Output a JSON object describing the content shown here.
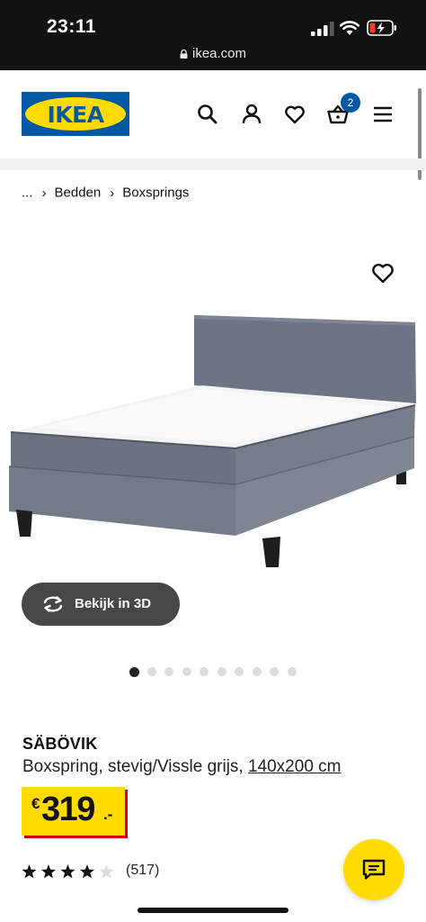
{
  "status_bar": {
    "time": "23:11",
    "url": "ikea.com"
  },
  "header": {
    "logo_text": "IKEA",
    "cart_count": "2",
    "icons": [
      "search-icon",
      "account-icon",
      "heart-icon",
      "cart-icon",
      "menu-icon"
    ]
  },
  "breadcrumb": {
    "items": [
      "...",
      "Bedden",
      "Boxsprings"
    ]
  },
  "gallery": {
    "view_3d_label": "Bekijk in 3D",
    "image_count": 10,
    "active_index": 0
  },
  "product": {
    "name": "SÄBÖVIK",
    "description": "Boxspring, stevig/Vissle grijs,",
    "size": "140x200 cm",
    "price": {
      "currency": "€",
      "amount": "319",
      "decimal": ".-"
    },
    "rating": 4,
    "rating_max": 5,
    "review_count": "(517)"
  },
  "colors": {
    "ikea_blue": "#0058a3",
    "ikea_yellow": "#ffdb00",
    "price_shadow": "#cc0008",
    "button_dark": "#474747"
  }
}
